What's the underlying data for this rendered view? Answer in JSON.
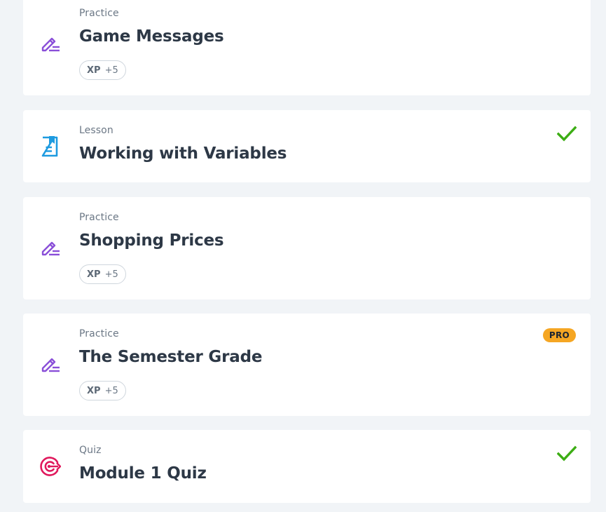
{
  "items": [
    {
      "type": "Practice",
      "title": "Game Messages",
      "xp_label": "XP",
      "xp_value": "+5",
      "icon": "pencil-icon",
      "completed": false,
      "pro": false
    },
    {
      "type": "Lesson",
      "title": "Working with Variables",
      "icon": "lesson-document-icon",
      "completed": true,
      "pro": false
    },
    {
      "type": "Practice",
      "title": "Shopping Prices",
      "xp_label": "XP",
      "xp_value": "+5",
      "icon": "pencil-icon",
      "completed": false,
      "pro": false
    },
    {
      "type": "Practice",
      "title": "The Semester Grade",
      "xp_label": "XP",
      "xp_value": "+5",
      "icon": "pencil-icon",
      "completed": false,
      "pro": true,
      "pro_label": "PRO"
    },
    {
      "type": "Quiz",
      "title": "Module 1 Quiz",
      "icon": "target-icon",
      "completed": true,
      "pro": false
    }
  ],
  "colors": {
    "practice_icon": "#8a4fd8",
    "lesson_icon": "#1e9be0",
    "quiz_icon": "#e0185c",
    "check": "#3cad14",
    "pro_badge": "#f5a623"
  }
}
